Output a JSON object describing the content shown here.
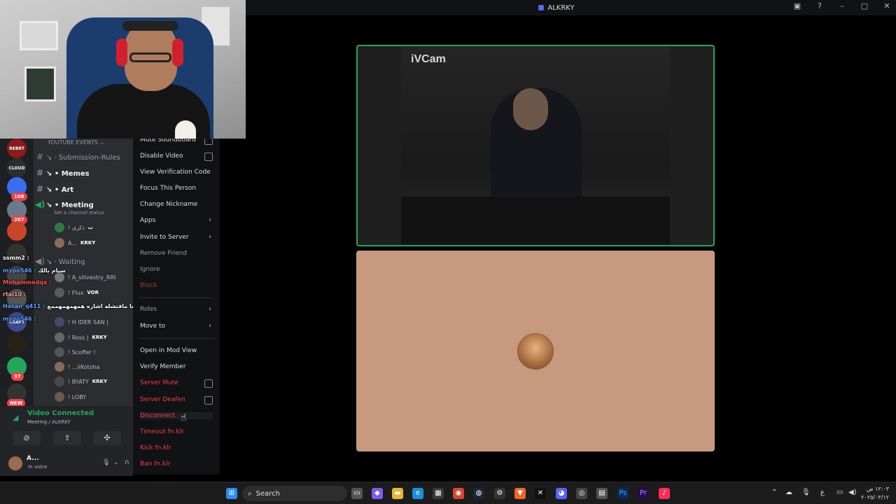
{
  "window": {
    "title": "ALKRKY"
  },
  "servers": [
    {
      "label": "REBRT",
      "color": "#8b1a1a"
    },
    {
      "label": "CLOUD",
      "color": "#2b2d31"
    },
    {
      "label": "",
      "color": "#3a6df0",
      "badge": "108"
    },
    {
      "label": "",
      "color": "#6b7a8a",
      "badge": "207"
    },
    {
      "label": "",
      "color": "#c8452a"
    },
    {
      "label": "",
      "color": "#333"
    },
    {
      "label": "",
      "color": "#444"
    },
    {
      "label": "",
      "color": "#555"
    },
    {
      "label": "CRAFT",
      "color": "#3b4a8a"
    },
    {
      "label": "",
      "color": "#2a2015"
    },
    {
      "label": "",
      "color": "#23a55a",
      "badge": "37"
    },
    {
      "label": "",
      "color": "#333",
      "badge": "NEW"
    }
  ],
  "channels": {
    "category": "YOUTUBE EVENTS",
    "items": [
      {
        "icon": "#",
        "name": "Submission-Rules"
      },
      {
        "icon": "#",
        "name": "Memes"
      },
      {
        "icon": "#",
        "name": "Art"
      }
    ],
    "voice": {
      "name": "Meeting",
      "status": "Set a channel status"
    },
    "members": [
      {
        "name": "! ذكرى",
        "tag": "ب"
      },
      {
        "name": "A...",
        "tag": "KRKY"
      }
    ],
    "waiting": "Waiting",
    "waiting_members": [
      {
        "name": "! A_silivestry_RRI",
        "tag": ""
      },
      {
        "name": "! Flux",
        "tag": "VOR"
      },
      {
        "name": "! H IDER SAN |",
        "tag": ""
      },
      {
        "name": "! Ross |",
        "tag": "KRKY"
      },
      {
        "name": "! Scoffer !",
        "tag": ""
      },
      {
        "name": "! ...iiKotoha",
        "tag": ""
      },
      {
        "name": "! BYATY",
        "tag": "KRKY"
      },
      {
        "name": "! LOBY",
        "tag": ""
      }
    ]
  },
  "chat": [
    {
      "user": "ssmm2 :",
      "msg": "",
      "color": "#ffffff"
    },
    {
      "user": "mypo546 :",
      "msg": "سيام بالك",
      "color": "#5b9cff"
    },
    {
      "user": "Mohammedqx :",
      "msg": "",
      "color": "#ff5050"
    },
    {
      "user": "rtal10 :",
      "msg": "",
      "color": "#ff9c9c"
    },
    {
      "user": "Hasan_q411 :",
      "msg": "لان جالغا مافتشله اشاره همهمهمهممع",
      "color": "#5b9cff"
    },
    {
      "user": "mypo546 :",
      "msg": "",
      "color": "#5b9cff"
    }
  ],
  "voice_panel": {
    "title": "Video Connected",
    "subtitle": "Meeting / ALKRKY",
    "user": "A...",
    "user_status": "In voice"
  },
  "context_menu": {
    "items": [
      {
        "label": "Mute Soundboard",
        "style": "normal",
        "type": "check"
      },
      {
        "label": "Disable Video",
        "style": "normal",
        "type": "check"
      },
      {
        "label": "View Verification Code",
        "style": "normal"
      },
      {
        "label": "Focus This Person",
        "style": "normal"
      },
      {
        "label": "Change Nickname",
        "style": "normal"
      },
      {
        "label": "Apps",
        "style": "normal",
        "type": "sub"
      },
      {
        "label": "Invite to Server",
        "style": "normal",
        "type": "sub"
      },
      {
        "label": "Remove Friend",
        "style": "dim"
      },
      {
        "label": "Ignore",
        "style": "dim"
      },
      {
        "label": "Block",
        "style": "dimdanger"
      },
      {
        "label": "Roles",
        "style": "dim",
        "type": "sub"
      },
      {
        "label": "Move to",
        "style": "normal",
        "type": "sub"
      },
      {
        "label": "Open in Mod View",
        "style": "normal"
      },
      {
        "label": "Verify Member",
        "style": "normal"
      },
      {
        "label": "Server Mute",
        "style": "danger",
        "type": "check"
      },
      {
        "label": "Server Deafen",
        "style": "danger",
        "type": "check"
      },
      {
        "label": "Disconnect",
        "style": "danger"
      },
      {
        "label": "Timeout fn.klr",
        "style": "danger"
      },
      {
        "label": "Kick fn.klr",
        "style": "danger"
      },
      {
        "label": "Ban fn.klr",
        "style": "danger"
      }
    ]
  },
  "stage": {
    "cam_label": "iVCam"
  },
  "taskbar": {
    "search": "Search",
    "time": "١٢:٠٣ ص",
    "date": "٢٠٢٥/٠٣/١٢"
  }
}
